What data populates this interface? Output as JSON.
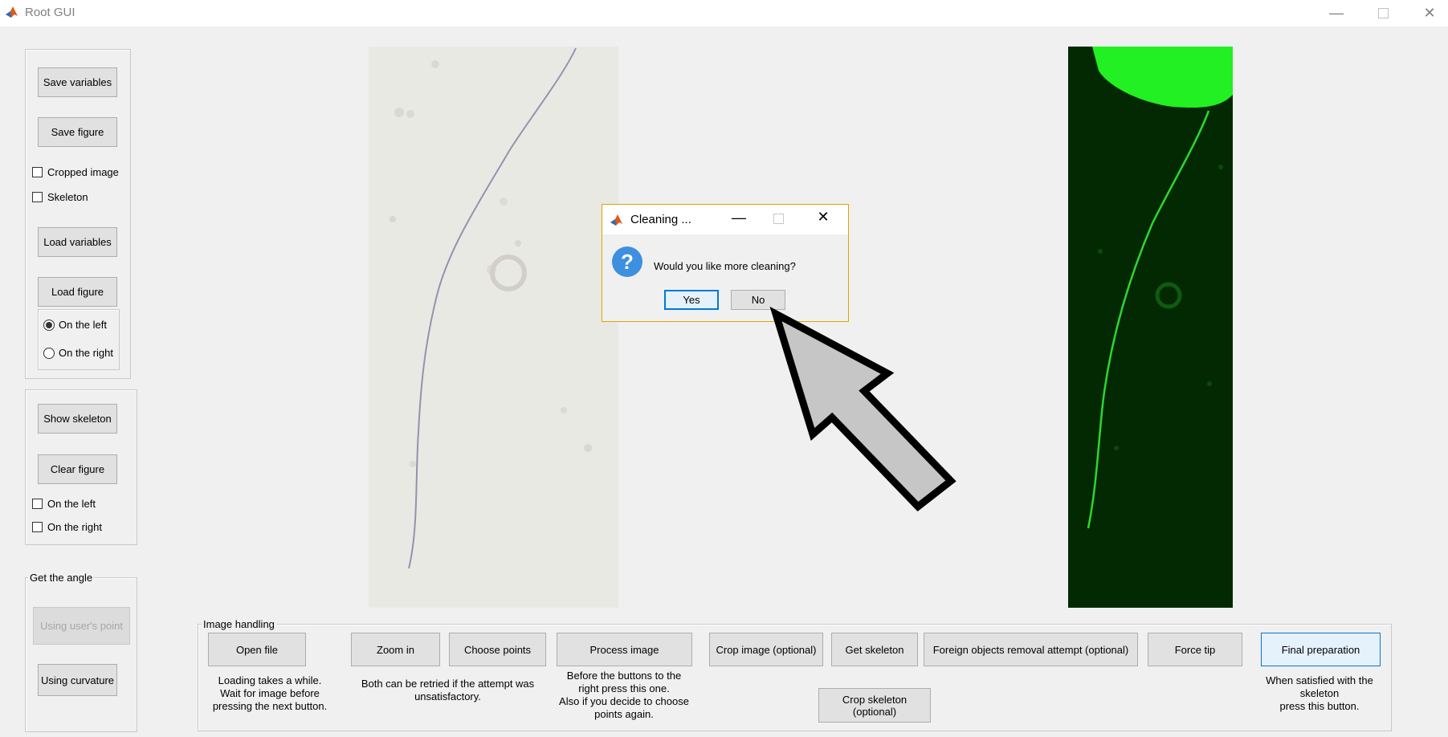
{
  "window": {
    "title": "Root GUI"
  },
  "left_panel": {
    "save_variables": "Save variables",
    "save_figure": "Save figure",
    "cropped_image": "Cropped image",
    "skeleton": "Skeleton",
    "load_variables": "Load variables",
    "load_figure": "Load figure",
    "on_the_left": "On the left",
    "on_the_right": "On the right"
  },
  "skeleton_panel": {
    "show_skeleton": "Show skeleton",
    "clear_figure": "Clear figure",
    "on_the_left": "On the left",
    "on_the_right": "On the right"
  },
  "angle_panel": {
    "title": "Get the angle",
    "using_users_point": "Using user's point",
    "using_curvature": "Using curvature"
  },
  "image_handling": {
    "title": "Image handling",
    "open_file": "Open file",
    "open_file_help": [
      "Loading takes a while.",
      "Wait for  image before",
      "pressing the next button."
    ],
    "zoom_in": "Zoom in",
    "choose_points": "Choose points",
    "zoom_help": [
      "Both can be retried if the attempt was",
      "unsatisfactory."
    ],
    "process_image": "Process image",
    "process_help": [
      "Before the buttons to the",
      "right press this one.",
      "Also if you decide to choose",
      "points again."
    ],
    "crop_image": "Crop image (optional)",
    "get_skeleton": "Get skeleton",
    "foreign_objects": "Foreign objects removal attempt (optional)",
    "force_tip": "Force tip",
    "final_preparation": "Final preparation",
    "final_help": [
      "When satisfied with the",
      "skeleton",
      "press this button."
    ],
    "crop_skeleton": "Crop skeleton (optional)"
  },
  "dialog": {
    "title": "Cleaning ...",
    "message": "Would you like more cleaning?",
    "yes": "Yes",
    "no": "No"
  },
  "colors": {
    "background": "#f0f0f0",
    "dialog_border": "#e6a100",
    "question_icon": "#3d8fe0",
    "fluorescence_green": "#22dd22"
  }
}
